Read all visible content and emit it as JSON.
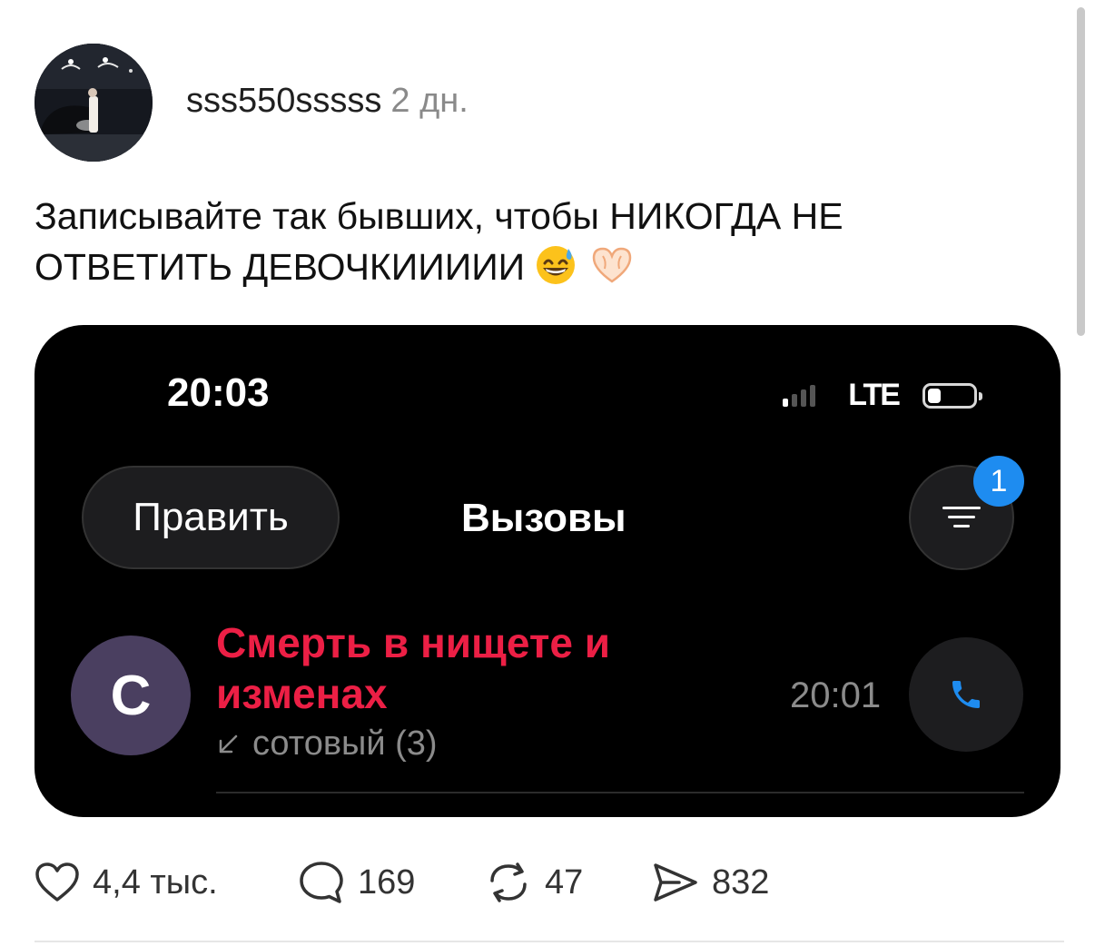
{
  "post": {
    "author": "sss550sssss",
    "time_ago": "2 дн.",
    "text": "Записывайте так бывших, чтобы НИКОГДА НЕ ОТВЕТИТЬ ДЕВОЧКИИИИИ",
    "emojis": [
      "grinning-sweat-emoji",
      "heart-hands-emoji"
    ]
  },
  "screenshot": {
    "status_bar": {
      "time": "20:03",
      "network": "LTE"
    },
    "edit_label": "Править",
    "title": "Вызовы",
    "filter_badge": "1",
    "call": {
      "avatar_letter": "С",
      "name": "Смерть в нищете и изменах",
      "subtitle": "сотовый (3)",
      "time": "20:01"
    }
  },
  "actions": {
    "likes": "4,4 тыс.",
    "comments": "169",
    "reposts": "47",
    "shares": "832"
  },
  "colors": {
    "accent_red": "#ec1f45",
    "accent_blue": "#1e8cf0",
    "screenshot_bg": "#000000"
  }
}
